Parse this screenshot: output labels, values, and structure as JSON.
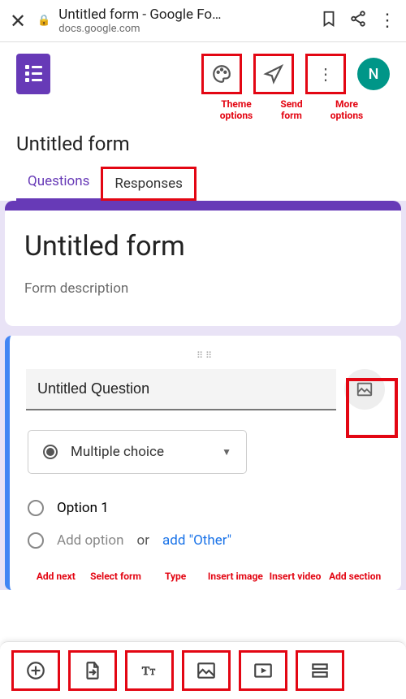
{
  "browser": {
    "title": "Untitled form - Google Fo…",
    "domain": "docs.google.com"
  },
  "header": {
    "theme_label": "Theme options",
    "send_label": "Send form",
    "more_label": "More options",
    "avatar_initial": "N"
  },
  "form": {
    "name": "Untitled form",
    "title": "Untitled form",
    "description": "Form description"
  },
  "tabs": {
    "questions": "Questions",
    "responses": "Responses"
  },
  "question": {
    "text": "Untitled Question",
    "type": "Multiple choice",
    "option1": "Option 1",
    "add_option": "Add option",
    "or": "or",
    "add_other": "add \"Other\""
  },
  "annot": {
    "insert_image": "Insert image",
    "add_next": "Add next",
    "select_form": "Select form",
    "type": "Type",
    "insert_image2": "Insert image",
    "insert_video": "Insert video",
    "add_section": "Add section"
  }
}
